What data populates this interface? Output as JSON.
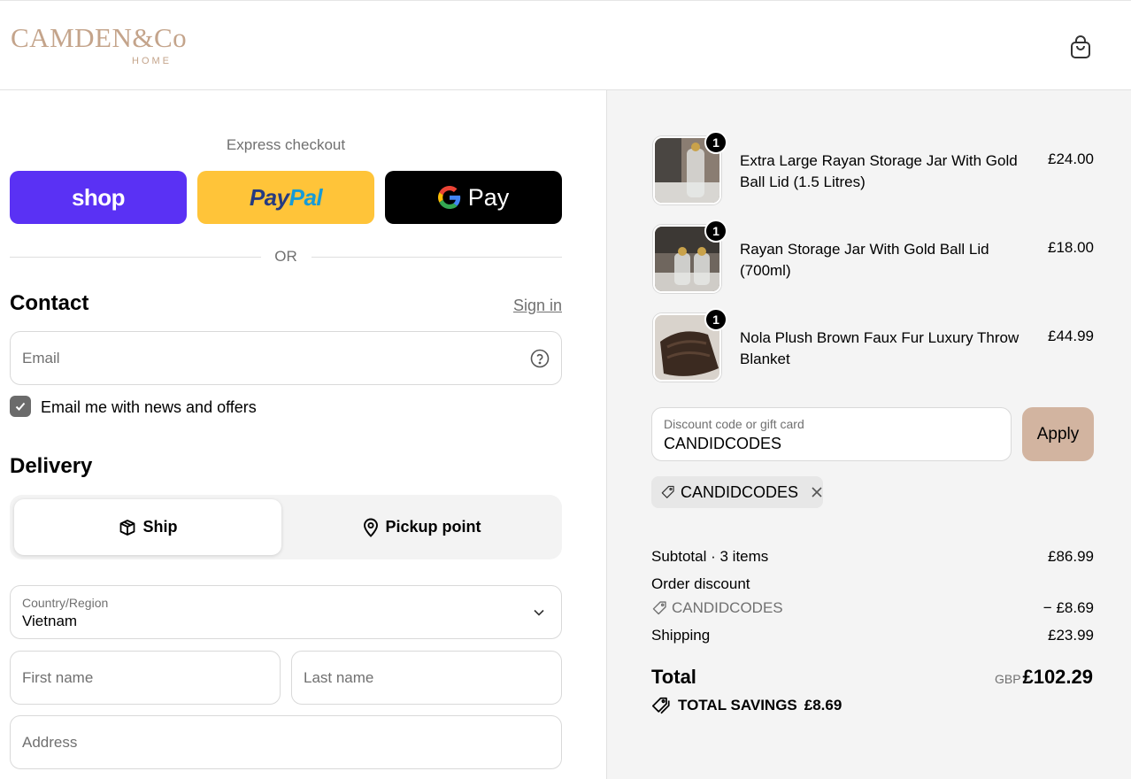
{
  "brand": {
    "name": "CAMDEN&Co",
    "sub": "HOME"
  },
  "express": {
    "title": "Express checkout",
    "shop_label": "shop",
    "paypal_pay": "Pay",
    "paypal_pal": "Pal",
    "gpay_label": "Pay",
    "or": "OR",
    "colors": {
      "shop": "#5a31f4",
      "paypal": "#ffc439",
      "gpay": "#000000"
    }
  },
  "contact": {
    "title": "Contact",
    "signin": "Sign in",
    "email_placeholder": "Email",
    "newsletter_label": "Email me with news and offers",
    "newsletter_checked": true
  },
  "delivery": {
    "title": "Delivery",
    "options": [
      {
        "label": "Ship",
        "selected": true,
        "icon": "package-icon"
      },
      {
        "label": "Pickup point",
        "selected": false,
        "icon": "map-pin-icon"
      }
    ],
    "country_label": "Country/Region",
    "country_value": "Vietnam",
    "first_name_placeholder": "First name",
    "last_name_placeholder": "Last name",
    "address_placeholder": "Address"
  },
  "order": {
    "items": [
      {
        "name": "Extra Large Rayan Storage Jar With Gold Ball Lid (1.5 Litres)",
        "price": "£24.00",
        "qty": "1"
      },
      {
        "name": "Rayan Storage Jar With Gold Ball Lid (700ml)",
        "price": "£18.00",
        "qty": "1"
      },
      {
        "name": "Nola Plush Brown Faux Fur Luxury Throw Blanket",
        "price": "£44.99",
        "qty": "1"
      }
    ],
    "discount_label": "Discount code or gift card",
    "discount_value": "CANDIDCODES",
    "apply": "Apply",
    "applied_code": "CANDIDCODES",
    "subtotal_label": "Subtotal · 3 items",
    "subtotal": "£86.99",
    "order_discount_label": "Order discount",
    "order_discount_code": "CANDIDCODES",
    "order_discount": "− £8.69",
    "shipping_label": "Shipping",
    "shipping": "£23.99",
    "total_label": "Total",
    "currency": "GBP",
    "total": "£102.29",
    "savings_label": "TOTAL SAVINGS",
    "savings": "£8.69",
    "accent": "#d2b4a0"
  }
}
